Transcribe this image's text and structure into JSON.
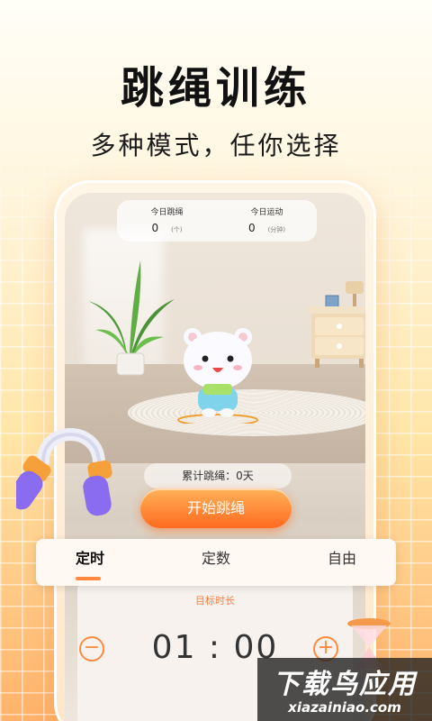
{
  "headline": "跳绳训练",
  "subheadline": "多种模式，任你选择",
  "stats": {
    "today_rope": {
      "label": "今日跳绳",
      "value": "0",
      "unit": "(个)"
    },
    "today_exercise": {
      "label": "今日运动",
      "value": "0",
      "unit": "(分钟)"
    }
  },
  "cumulative": "累计跳绳：0天",
  "start_button": "开始跳绳",
  "tabs": [
    {
      "label": "定时",
      "active": true
    },
    {
      "label": "定数",
      "active": false
    },
    {
      "label": "自由",
      "active": false
    }
  ],
  "timer": {
    "goal_label": "目标时长",
    "value": "01 : 00",
    "minus": "−",
    "plus": "+"
  },
  "watermark": {
    "main": "下载鸟应用",
    "sub": "xiazainiao.com"
  },
  "colors": {
    "accent": "#ff8a3d",
    "button": "#ff6a1e"
  }
}
